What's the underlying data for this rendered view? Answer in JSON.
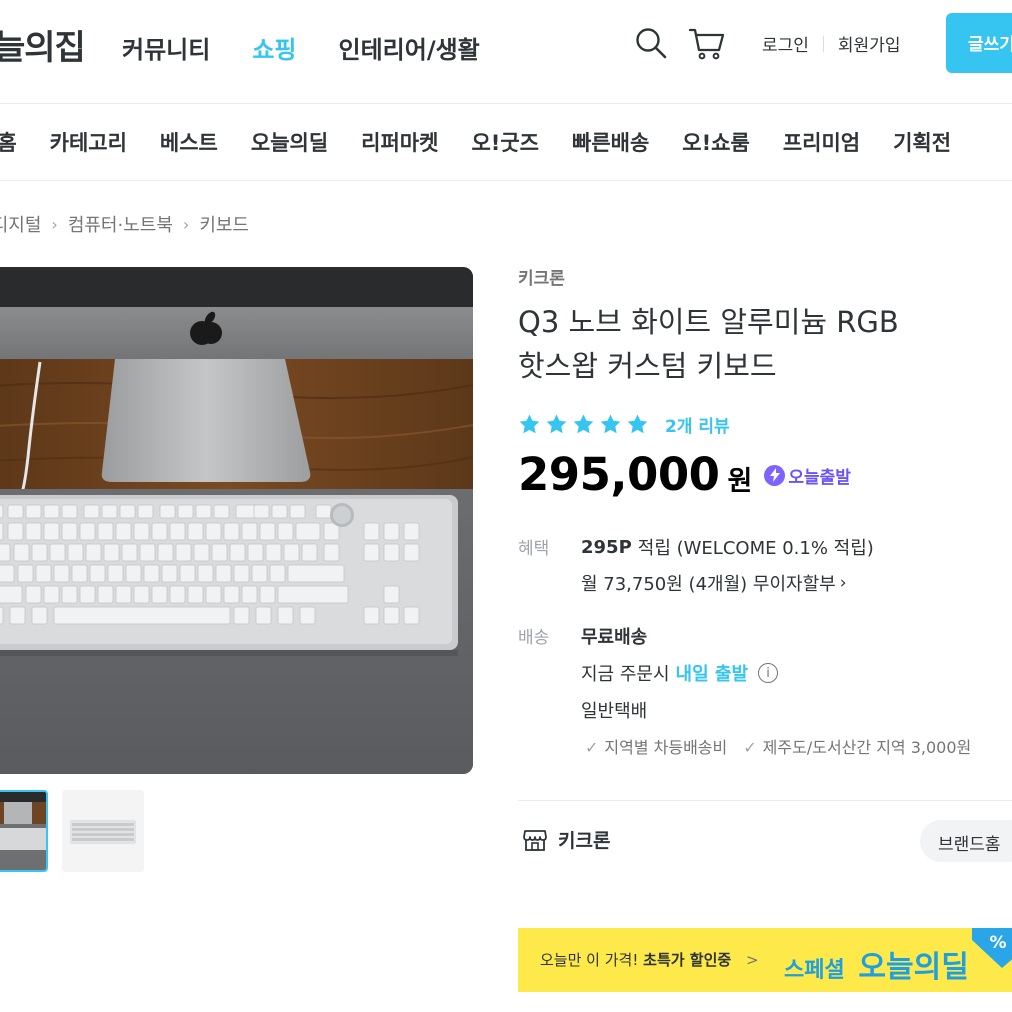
{
  "header": {
    "logo": "늘의집",
    "nav_main": [
      "커뮤니티",
      "쇼핑",
      "인테리어/생활"
    ],
    "nav_main_active": "쇼핑",
    "login": "로그인",
    "signup": "회원가입",
    "write_button": "글쓰기"
  },
  "sub_nav": [
    "핑홈",
    "카테고리",
    "베스트",
    "오늘의딜",
    "리퍼마켓",
    "오!굿즈",
    "빠른배송",
    "오!쇼룸",
    "프리미엄",
    "기획전"
  ],
  "breadcrumb": [
    "·디지털",
    "컴퓨터·노트북",
    "키보드"
  ],
  "product": {
    "brand": "키크론",
    "title_line1": "Q3 노브 화이트 알루미늄 RGB",
    "title_line2": "핫스왑 커스텀 키보드",
    "rating_stars": 5,
    "review_count": "2개 리뷰",
    "price": "295,000",
    "currency": "원",
    "delivery_badge": "오늘출발"
  },
  "benefit": {
    "label": "혜택",
    "points": "295P",
    "points_rest": "적립 (WELCOME 0.1% 적립)",
    "installment": "월 73,750원 (4개월) 무이자할부"
  },
  "shipping": {
    "label": "배송",
    "type": "무료배송",
    "order_prefix": "지금 주문시",
    "order_accent": "내일 출발",
    "method": "일반택배",
    "notes": [
      "지역별 차등배송비",
      "제주도/도서산간 지역 3,000원"
    ]
  },
  "store": {
    "name": "키크론",
    "brand_home": "브랜드홈"
  },
  "banner": {
    "text_plain": "오늘만 이 가격!",
    "text_bold": "초특가 할인중",
    "chevron": ">",
    "special": "스페셜",
    "deal": "오늘의딜",
    "tag": "%"
  },
  "colors": {
    "accent": "#35c5f0",
    "badge": "#6b53f5",
    "banner": "#fde94a",
    "banner_text": "#1f9fe0"
  }
}
